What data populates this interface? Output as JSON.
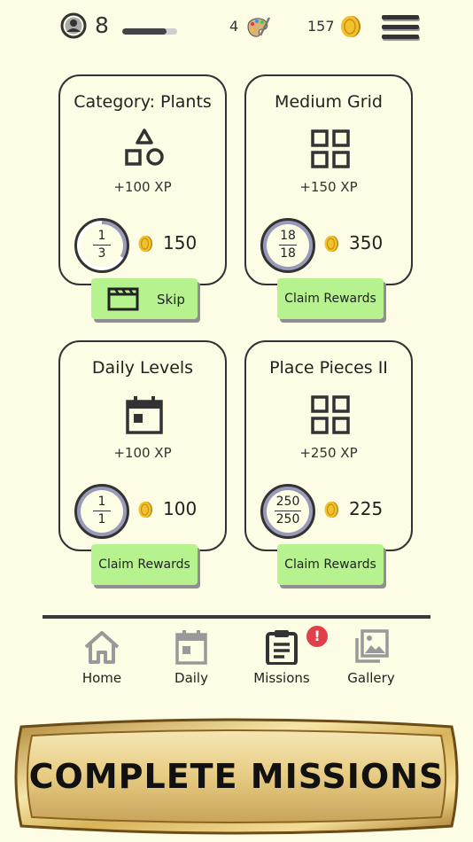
{
  "topbar": {
    "level": "8",
    "xp_progress": 0.8,
    "palettes": "4",
    "coins": "157",
    "avatar_icon": "user-circle-icon",
    "palette_icon": "palette-icon",
    "coin_icon": "coin-icon",
    "menu_icon": "hamburger-menu-icon"
  },
  "missions": [
    {
      "title": "Category: Plants",
      "icon": "shapes-icon",
      "xp": "+100 XP",
      "progress_current": "1",
      "progress_total": "3",
      "progress_fraction": 0.333,
      "reward": "150",
      "button": "Skip",
      "button_icon": "clapperboard-icon"
    },
    {
      "title": "Medium Grid",
      "icon": "grid-icon",
      "xp": "+150 XP",
      "progress_current": "18",
      "progress_total": "18",
      "progress_fraction": 1.0,
      "reward": "350",
      "button": "Claim Rewards"
    },
    {
      "title": "Daily Levels",
      "icon": "calendar-icon",
      "xp": "+100 XP",
      "progress_current": "1",
      "progress_total": "1",
      "progress_fraction": 1.0,
      "reward": "100",
      "button": "Claim Rewards"
    },
    {
      "title": "Place Pieces II",
      "icon": "grid-icon",
      "xp": "+250 XP",
      "progress_current": "250",
      "progress_total": "250",
      "progress_fraction": 1.0,
      "reward": "225",
      "button": "Claim Rewards"
    }
  ],
  "nav": {
    "items": [
      {
        "label": "Home",
        "icon": "home-icon",
        "active": false
      },
      {
        "label": "Daily",
        "icon": "calendar-icon",
        "active": false
      },
      {
        "label": "Missions",
        "icon": "clipboard-icon",
        "active": true
      },
      {
        "label": "Gallery",
        "icon": "gallery-icon",
        "active": false
      }
    ],
    "badge": "!"
  },
  "banner": {
    "text": "COMPLETE MISSIONS"
  },
  "colors": {
    "background": "#fdfce4",
    "button": "#b6f38f",
    "coin": "#e8b21a",
    "progress_ring": "#9a9ab8",
    "badge": "#e0404a",
    "banner_gold": "#d8b45a"
  }
}
